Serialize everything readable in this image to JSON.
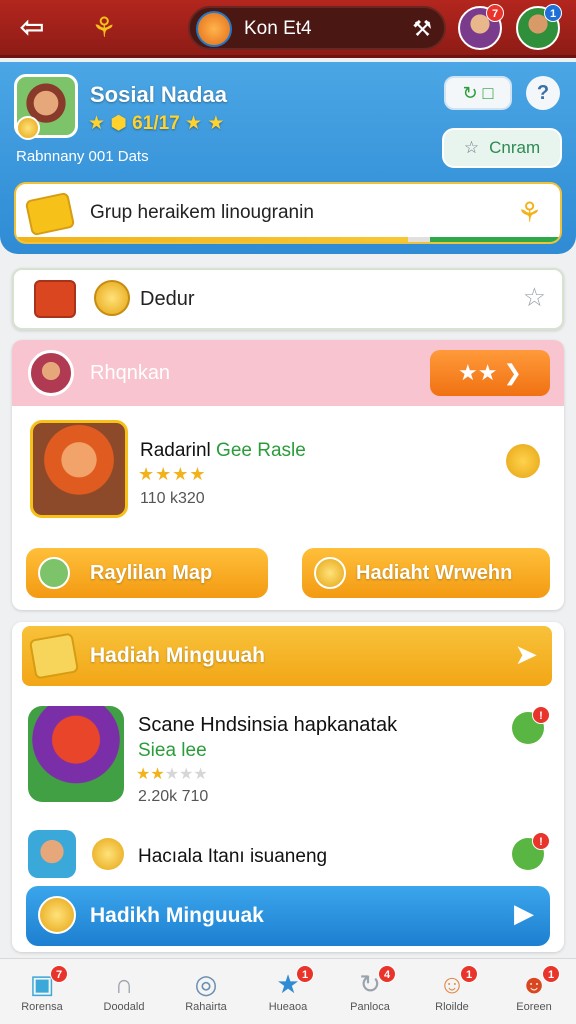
{
  "topbar": {
    "title": "Kon Et4",
    "avatar1_badge": "7",
    "avatar2_badge": "1"
  },
  "profile": {
    "name": "Sosial Nadaa",
    "level": "★ ⬢ 61/17 ★ ★",
    "subtitle": "Rabnnany 001 Dats",
    "button_label": "Cnram",
    "banner_text": "Grup heraikem linougranin",
    "banner_progress_percent": 72
  },
  "daily": {
    "label": "Dedur"
  },
  "friends": {
    "title": "Rhqnkan",
    "game_name": "Radarinl",
    "game_name_green": "Gee Rasle",
    "game_stars": "★★★★",
    "game_meta": "110 k320",
    "button_left": "Raylilan Map",
    "button_right": "Hadiaht Wrwehn"
  },
  "rewards": {
    "title": "Hadiah Minguuah",
    "item1_line1": "Scane Hndsinsia hapkanatak",
    "item1_line2": "Siea lee",
    "item1_stars_on": "★★",
    "item1_stars_off": "★★★",
    "item1_meta": "2.20k 710",
    "item2_text": "Hacıala Itanı isuaneng",
    "button_label": "Hadikh Minguuak"
  },
  "nav": [
    {
      "label": "Rorensa",
      "badge": "7"
    },
    {
      "label": "Doodald",
      "badge": ""
    },
    {
      "label": "Rahairta",
      "badge": ""
    },
    {
      "label": "Hueaoa",
      "badge": "1"
    },
    {
      "label": "Panloca",
      "badge": "4"
    },
    {
      "label": "Rloilde",
      "badge": "1"
    },
    {
      "label": "Eoreen",
      "badge": "1"
    }
  ],
  "colors": {
    "topbar": "#b3261e",
    "profile_blue": "#2f8bd4",
    "friends_pink": "#f8c4cf",
    "orange_button": "#f39a12",
    "rewards_yellow": "#f2a616",
    "blue_button": "#1d7fd0"
  }
}
